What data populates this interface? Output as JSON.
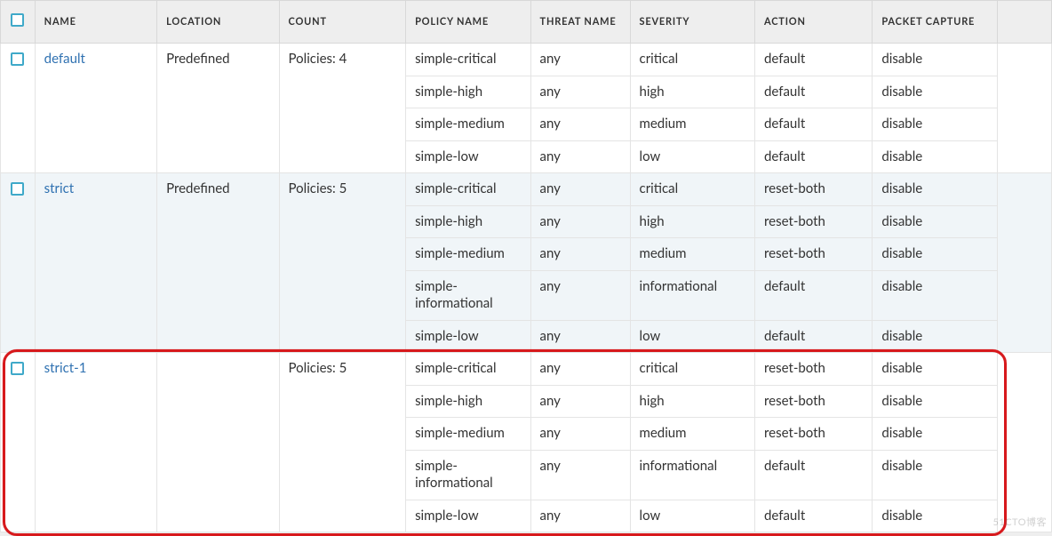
{
  "columns": {
    "name": "NAME",
    "location": "LOCATION",
    "count": "COUNT",
    "policy_name": "POLICY NAME",
    "threat_name": "THREAT NAME",
    "severity": "SEVERITY",
    "action": "ACTION",
    "packet_capture": "PACKET CAPTURE"
  },
  "profiles": [
    {
      "name": "default",
      "location": "Predefined",
      "count": "Policies: 4",
      "highlighted": false,
      "alt": false,
      "policies": [
        {
          "policy_name": "simple-critical",
          "threat_name": "any",
          "severity": "critical",
          "action": "default",
          "packet_capture": "disable"
        },
        {
          "policy_name": "simple-high",
          "threat_name": "any",
          "severity": "high",
          "action": "default",
          "packet_capture": "disable"
        },
        {
          "policy_name": "simple-medium",
          "threat_name": "any",
          "severity": "medium",
          "action": "default",
          "packet_capture": "disable"
        },
        {
          "policy_name": "simple-low",
          "threat_name": "any",
          "severity": "low",
          "action": "default",
          "packet_capture": "disable"
        }
      ]
    },
    {
      "name": "strict",
      "location": "Predefined",
      "count": "Policies: 5",
      "highlighted": false,
      "alt": true,
      "policies": [
        {
          "policy_name": "simple-critical",
          "threat_name": "any",
          "severity": "critical",
          "action": "reset-both",
          "packet_capture": "disable"
        },
        {
          "policy_name": "simple-high",
          "threat_name": "any",
          "severity": "high",
          "action": "reset-both",
          "packet_capture": "disable"
        },
        {
          "policy_name": "simple-medium",
          "threat_name": "any",
          "severity": "medium",
          "action": "reset-both",
          "packet_capture": "disable"
        },
        {
          "policy_name": "simple-informational",
          "threat_name": "any",
          "severity": "informational",
          "action": "default",
          "packet_capture": "disable"
        },
        {
          "policy_name": "simple-low",
          "threat_name": "any",
          "severity": "low",
          "action": "default",
          "packet_capture": "disable"
        }
      ]
    },
    {
      "name": "strict-1",
      "location": "",
      "count": "Policies: 5",
      "highlighted": true,
      "alt": false,
      "policies": [
        {
          "policy_name": "simple-critical",
          "threat_name": "any",
          "severity": "critical",
          "action": "reset-both",
          "packet_capture": "disable"
        },
        {
          "policy_name": "simple-high",
          "threat_name": "any",
          "severity": "high",
          "action": "reset-both",
          "packet_capture": "disable"
        },
        {
          "policy_name": "simple-medium",
          "threat_name": "any",
          "severity": "medium",
          "action": "reset-both",
          "packet_capture": "disable"
        },
        {
          "policy_name": "simple-informational",
          "threat_name": "any",
          "severity": "informational",
          "action": "default",
          "packet_capture": "disable"
        },
        {
          "policy_name": "simple-low",
          "threat_name": "any",
          "severity": "low",
          "action": "default",
          "packet_capture": "disable"
        }
      ]
    }
  ],
  "watermark": "51CTO博客"
}
